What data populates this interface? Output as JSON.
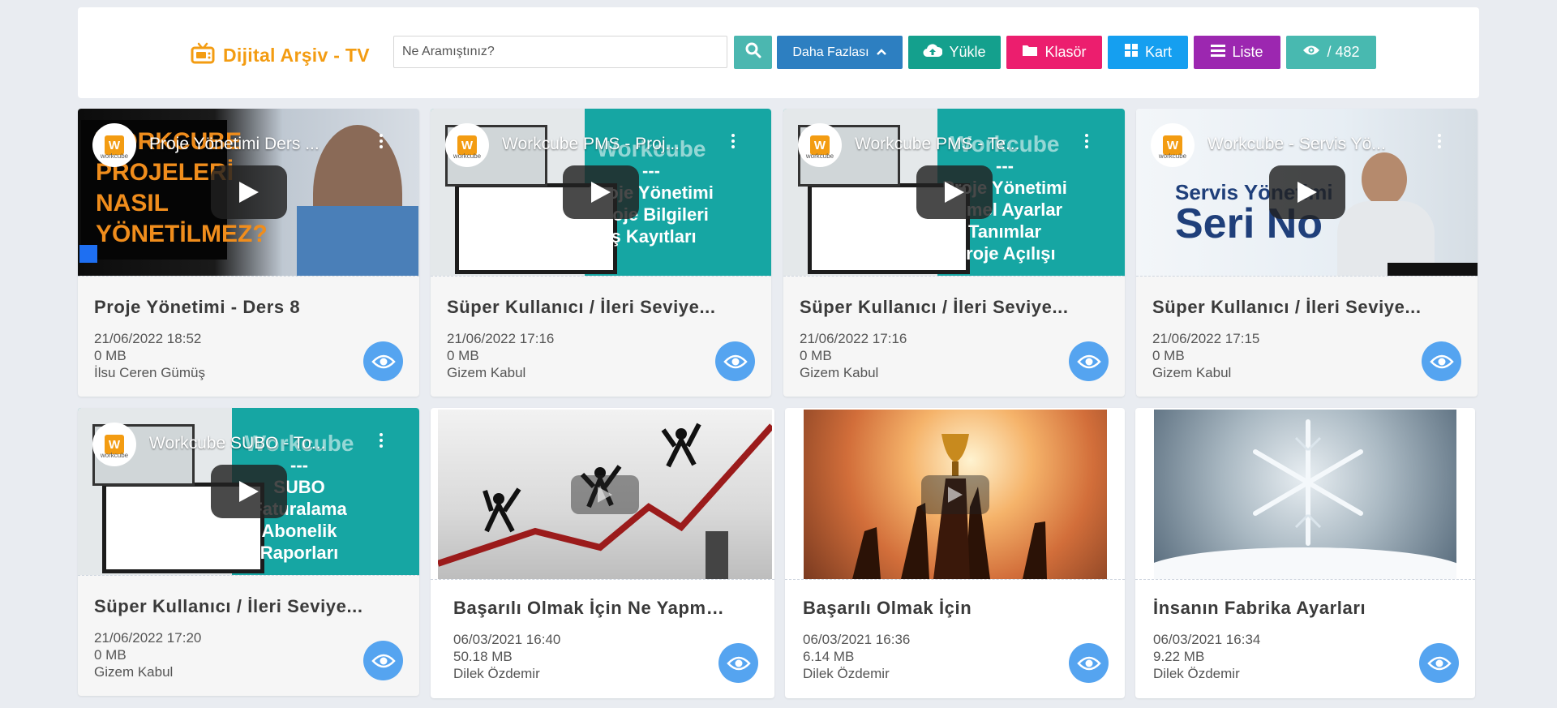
{
  "header": {
    "brand_title": "Dijital Arşiv - TV",
    "search_placeholder": "Ne Aramıştınız?",
    "more_label": "Daha Fazlası",
    "upload_label": "Yükle",
    "folder_label": "Klasör",
    "card_label": "Kart",
    "list_label": "Liste",
    "views_label": "/ 482",
    "colors": {
      "brand": "#f39c12",
      "search": "#4bb7b0",
      "more": "#2d7fc1",
      "upload": "#14a08d",
      "folder": "#ec1e6e",
      "card": "#159ff0",
      "list": "#9c27b0",
      "views": "#48b9b0"
    }
  },
  "cards": [
    {
      "title": "Proje Yönetimi - Ders 8",
      "date": "21/06/2022 18:52",
      "size": "0 MB",
      "author": "İlsu Ceren Gümüş",
      "video_title": "Proje Yönetimi Ders ...",
      "thumb_text": [
        "WORKCUBE",
        "PROJELERİ",
        "NASIL",
        "YÖNETİLMEZ?"
      ],
      "thumb": "orange-black"
    },
    {
      "title": "Süper Kullanıcı / İleri Seviye...",
      "date": "21/06/2022 17:16",
      "size": "0 MB",
      "author": "Gizem Kabul",
      "video_title": "Workcube PMS - Proj...",
      "thumb_text": [
        "Workcube",
        "---",
        "Proje Yönetimi",
        "Proje Bilgileri",
        "İş Kayıtları"
      ],
      "thumb": "teal"
    },
    {
      "title": "Süper Kullanıcı / İleri Seviye...",
      "date": "21/06/2022 17:16",
      "size": "0 MB",
      "author": "Gizem Kabul",
      "video_title": "Workcube PMS - Te...",
      "thumb_text": [
        "Workcube",
        "---",
        "Proje Yönetimi",
        "Temel Ayarlar",
        "Tanımlar",
        "Proje Açılışı"
      ],
      "thumb": "teal"
    },
    {
      "title": "Süper Kullanıcı / İleri Seviye...",
      "date": "21/06/2022 17:15",
      "size": "0 MB",
      "author": "Gizem Kabul",
      "video_title": "Workcube - Servis Yö...",
      "thumb_text": [
        "Servis Yönetimi",
        "Seri No"
      ],
      "thumb": "service"
    },
    {
      "title": "Süper Kullanıcı / İleri Seviye...",
      "date": "21/06/2022 17:20",
      "size": "0 MB",
      "author": "Gizem Kabul",
      "video_title": "Workcube SUBO - To...",
      "thumb_text": [
        "Workcube",
        "---",
        "SUBO",
        "Faturalama",
        "Abonelik",
        "Raporları"
      ],
      "thumb": "teal"
    },
    {
      "title": "Başarılı Olmak İçin Ne Yapmalı?",
      "date": "06/03/2021 16:40",
      "size": "50.18 MB",
      "author": "Dilek Özdemir",
      "thumb": "graph"
    },
    {
      "title": "Başarılı Olmak İçin",
      "date": "06/03/2021 16:36",
      "size": "6.14 MB",
      "author": "Dilek Özdemir",
      "thumb": "trophy"
    },
    {
      "title": "İnsanın Fabrika Ayarları",
      "date": "06/03/2021 16:34",
      "size": "9.22 MB",
      "author": "Dilek Özdemir",
      "thumb": "snow"
    }
  ]
}
